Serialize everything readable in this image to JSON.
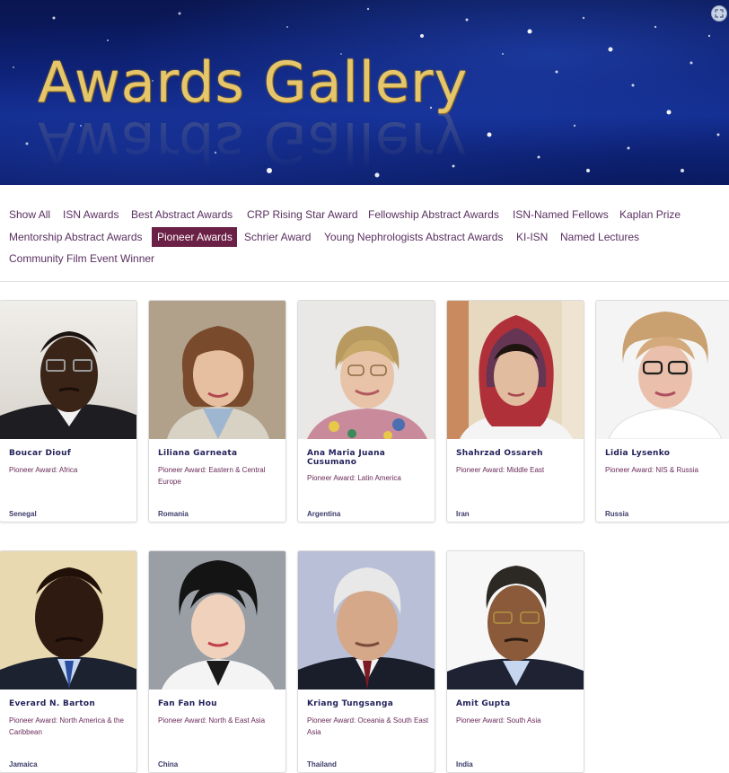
{
  "banner": {
    "title": "Awards Gallery"
  },
  "filters": [
    {
      "label": "Show All",
      "active": false
    },
    {
      "label": "ISN Awards",
      "active": false
    },
    {
      "label": "Best Abstract Awards",
      "active": false
    },
    {
      "label": "CRP Rising Star Award",
      "active": false
    },
    {
      "label": "Fellowship Abstract Awards",
      "active": false
    },
    {
      "label": "ISN-Named Fellows",
      "active": false
    },
    {
      "label": "Kaplan Prize",
      "active": false
    },
    {
      "label": "Mentorship Abstract Awards",
      "active": false
    },
    {
      "label": "Pioneer Awards",
      "active": true
    },
    {
      "label": "Schrier Award",
      "active": false
    },
    {
      "label": "Young Nephrologists Abstract Awards",
      "active": false
    },
    {
      "label": "KI-ISN",
      "active": false
    },
    {
      "label": "Named Lectures",
      "active": false
    },
    {
      "label": "Community Film Event Winner",
      "active": false
    }
  ],
  "colors": {
    "active_filter_bg": "#6b2046",
    "filter_text": "#5a3060",
    "name_text": "#22215a",
    "banner_gold": "#e6c66a"
  },
  "awardees": [
    {
      "name": "Boucar Diouf",
      "award": "Pioneer Award: Africa",
      "country": "Senegal"
    },
    {
      "name": "Liliana Garneata",
      "award": "Pioneer Award: Eastern & Central Europe",
      "country": "Romania"
    },
    {
      "name": "Ana Maria Juana Cusumano",
      "award": "Pioneer Award: Latin America",
      "country": "Argentina"
    },
    {
      "name": "Shahrzad Ossareh",
      "award": "Pioneer Award: Middle East",
      "country": "Iran"
    },
    {
      "name": "Lidia Lysenko",
      "award": "Pioneer Award: NIS & Russia",
      "country": "Russia"
    },
    {
      "name": "Everard N. Barton",
      "award": "Pioneer Award: North America & the Caribbean",
      "country": "Jamaica"
    },
    {
      "name": "Fan Fan Hou",
      "award": "Pioneer Award: North & East Asia",
      "country": "China"
    },
    {
      "name": "Kriang Tungsanga",
      "award": "Pioneer Award: Oceania & South East Asia",
      "country": "Thailand"
    },
    {
      "name": "Amit Gupta",
      "award": "Pioneer Award: South Asia",
      "country": "India"
    }
  ]
}
